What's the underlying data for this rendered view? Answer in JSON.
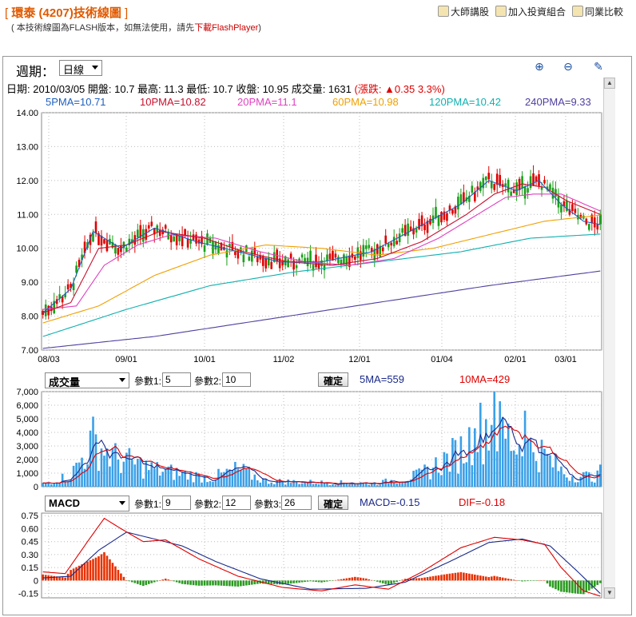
{
  "header": {
    "title": "環泰 (4207)技術線圖",
    "note": "( 本技術線圖為FLASH版本，如無法使用，請先",
    "note_link": "下載FlashPlayer",
    "note_end": ")",
    "links": [
      "大師講股",
      "加入投資組合",
      "同業比較"
    ]
  },
  "toolbar": {
    "period_label": "週期：",
    "period_value": "日線",
    "zoom_in_icon": "zoom-in-icon",
    "zoom_out_icon": "zoom-out-icon",
    "draw_icon": "pencil-icon"
  },
  "info": {
    "text": "日期: 2010/03/05  開盤: 10.7  最高: 11.3  最低: 10.7  收盤: 10.95  成交量: 1631",
    "change_label": "(漲跌: ",
    "change_value": "▲0.35 3.3%)"
  },
  "ma_labels": [
    {
      "text": "5PMA=10.71",
      "color": "#1f5fbf"
    },
    {
      "text": "10PMA=10.82",
      "color": "#c8102e"
    },
    {
      "text": "20PMA=11.1",
      "color": "#e040c0"
    },
    {
      "text": "60PMA=10.98",
      "color": "#f0a000"
    },
    {
      "text": "120PMA=10.42",
      "color": "#10b0b0"
    },
    {
      "text": "240PMA=9.33",
      "color": "#5040a0"
    }
  ],
  "volume_bar": {
    "indicator": "成交量",
    "param1_label": "參數1:",
    "param1": "5",
    "param2_label": "參數2:",
    "param2": "10",
    "confirm": "確定",
    "ma5": "5MA=559",
    "ma10": "10MA=429"
  },
  "macd_bar": {
    "indicator": "MACD",
    "param1_label": "參數1:",
    "param1": "9",
    "param2_label": "參數2:",
    "param2": "12",
    "param3_label": "參數3:",
    "param3": "26",
    "confirm": "確定",
    "macd": "MACD=-0.15",
    "dif": "DIF=-0.18"
  },
  "colors": {
    "up": "#e00000",
    "down": "#19a019",
    "vol": "#3aa0e8",
    "ma5": "#1f5fbf",
    "ma10": "#c8102e",
    "ma20": "#e040c0",
    "ma60": "#f0a000",
    "ma120": "#10b0b0",
    "ma240": "#5040a0"
  },
  "chart_data": [
    {
      "type": "candlestick",
      "x_ticks": [
        "08/03",
        "09/01",
        "10/01",
        "11/02",
        "12/01",
        "01/04",
        "02/01",
        "03/01"
      ],
      "y_ticks": [
        "14.00",
        "13.00",
        "12.00",
        "11.00",
        "10.00",
        "9.00",
        "8.00",
        "7.00"
      ],
      "ylim": [
        7,
        14
      ],
      "ma_anchors": {
        "ma5": [
          [
            0,
            8.1
          ],
          [
            10,
            8.8
          ],
          [
            18,
            10.5
          ],
          [
            28,
            10.0
          ],
          [
            40,
            10.6
          ],
          [
            55,
            10.2
          ],
          [
            70,
            9.9
          ],
          [
            85,
            9.6
          ],
          [
            100,
            9.6
          ],
          [
            118,
            9.9
          ],
          [
            134,
            10.6
          ],
          [
            150,
            11.3
          ],
          [
            160,
            12.0
          ],
          [
            170,
            11.7
          ],
          [
            178,
            12.0
          ],
          [
            186,
            11.3
          ],
          [
            194,
            10.8
          ],
          [
            200,
            10.7
          ]
        ],
        "ma10": [
          [
            0,
            8.1
          ],
          [
            10,
            8.4
          ],
          [
            20,
            10.0
          ],
          [
            30,
            10.1
          ],
          [
            42,
            10.5
          ],
          [
            58,
            10.3
          ],
          [
            72,
            9.9
          ],
          [
            88,
            9.6
          ],
          [
            104,
            9.5
          ],
          [
            120,
            9.7
          ],
          [
            136,
            10.2
          ],
          [
            152,
            11.0
          ],
          [
            162,
            11.6
          ],
          [
            172,
            11.9
          ],
          [
            180,
            11.8
          ],
          [
            188,
            11.4
          ],
          [
            200,
            11.0
          ]
        ],
        "ma20": [
          [
            0,
            8.2
          ],
          [
            12,
            8.3
          ],
          [
            22,
            9.5
          ],
          [
            34,
            10.1
          ],
          [
            46,
            10.4
          ],
          [
            62,
            10.3
          ],
          [
            78,
            9.9
          ],
          [
            94,
            9.6
          ],
          [
            110,
            9.5
          ],
          [
            126,
            9.7
          ],
          [
            142,
            10.3
          ],
          [
            156,
            11.0
          ],
          [
            166,
            11.5
          ],
          [
            176,
            11.6
          ],
          [
            186,
            11.6
          ],
          [
            200,
            11.1
          ]
        ],
        "ma60": [
          [
            0,
            7.8
          ],
          [
            20,
            8.3
          ],
          [
            40,
            9.2
          ],
          [
            60,
            9.8
          ],
          [
            80,
            10.1
          ],
          [
            100,
            10.0
          ],
          [
            120,
            9.8
          ],
          [
            140,
            10.0
          ],
          [
            160,
            10.4
          ],
          [
            180,
            10.8
          ],
          [
            200,
            10.98
          ]
        ],
        "ma120": [
          [
            0,
            7.4
          ],
          [
            30,
            8.2
          ],
          [
            60,
            8.9
          ],
          [
            90,
            9.3
          ],
          [
            120,
            9.6
          ],
          [
            150,
            9.9
          ],
          [
            175,
            10.3
          ],
          [
            200,
            10.42
          ]
        ],
        "ma240": [
          [
            0,
            7.05
          ],
          [
            40,
            7.4
          ],
          [
            80,
            7.9
          ],
          [
            120,
            8.4
          ],
          [
            160,
            8.9
          ],
          [
            200,
            9.33
          ]
        ]
      }
    },
    {
      "type": "bar",
      "title": "成交量",
      "y_ticks": [
        "7,000",
        "6,000",
        "5,000",
        "4,000",
        "3,000",
        "2,000",
        "1,000",
        "0"
      ],
      "ylim": [
        0,
        7000
      ]
    },
    {
      "type": "bar+line",
      "title": "MACD",
      "y_ticks": [
        "0.75",
        "0.60",
        "0.45",
        "0.30",
        "0.15",
        "0",
        "-0.15"
      ],
      "ylim": [
        -0.2,
        0.78
      ]
    }
  ]
}
